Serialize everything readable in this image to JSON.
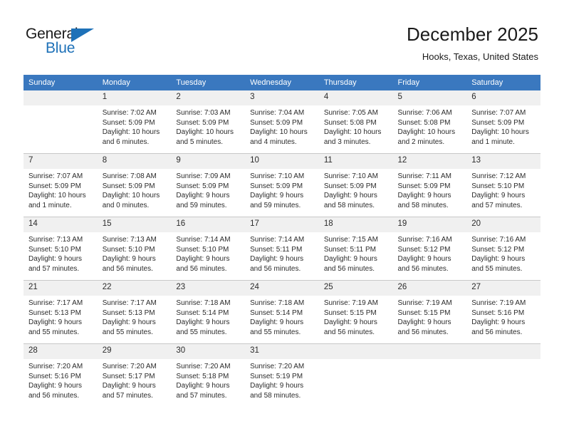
{
  "brand": {
    "name_part1": "General",
    "name_part2": "Blue",
    "triangle_icon": "triangle-icon",
    "color_dark": "#1a1a1a",
    "color_blue": "#1e71b8"
  },
  "header": {
    "title": "December 2025",
    "subtitle": "Hooks, Texas, United States"
  },
  "theme": {
    "header_bg": "#3a78bf",
    "header_text": "#ffffff",
    "daynum_bg": "#f0f0f0",
    "row_divider": "#c8c8c8",
    "body_text": "#2b2b2b"
  },
  "weekdays": [
    "Sunday",
    "Monday",
    "Tuesday",
    "Wednesday",
    "Thursday",
    "Friday",
    "Saturday"
  ],
  "weeks": [
    [
      {
        "day": "",
        "sunrise": "",
        "sunset": "",
        "daylight_line1": "",
        "daylight_line2": ""
      },
      {
        "day": "1",
        "sunrise": "Sunrise: 7:02 AM",
        "sunset": "Sunset: 5:09 PM",
        "daylight_line1": "Daylight: 10 hours",
        "daylight_line2": "and 6 minutes."
      },
      {
        "day": "2",
        "sunrise": "Sunrise: 7:03 AM",
        "sunset": "Sunset: 5:09 PM",
        "daylight_line1": "Daylight: 10 hours",
        "daylight_line2": "and 5 minutes."
      },
      {
        "day": "3",
        "sunrise": "Sunrise: 7:04 AM",
        "sunset": "Sunset: 5:09 PM",
        "daylight_line1": "Daylight: 10 hours",
        "daylight_line2": "and 4 minutes."
      },
      {
        "day": "4",
        "sunrise": "Sunrise: 7:05 AM",
        "sunset": "Sunset: 5:08 PM",
        "daylight_line1": "Daylight: 10 hours",
        "daylight_line2": "and 3 minutes."
      },
      {
        "day": "5",
        "sunrise": "Sunrise: 7:06 AM",
        "sunset": "Sunset: 5:08 PM",
        "daylight_line1": "Daylight: 10 hours",
        "daylight_line2": "and 2 minutes."
      },
      {
        "day": "6",
        "sunrise": "Sunrise: 7:07 AM",
        "sunset": "Sunset: 5:09 PM",
        "daylight_line1": "Daylight: 10 hours",
        "daylight_line2": "and 1 minute."
      }
    ],
    [
      {
        "day": "7",
        "sunrise": "Sunrise: 7:07 AM",
        "sunset": "Sunset: 5:09 PM",
        "daylight_line1": "Daylight: 10 hours",
        "daylight_line2": "and 1 minute."
      },
      {
        "day": "8",
        "sunrise": "Sunrise: 7:08 AM",
        "sunset": "Sunset: 5:09 PM",
        "daylight_line1": "Daylight: 10 hours",
        "daylight_line2": "and 0 minutes."
      },
      {
        "day": "9",
        "sunrise": "Sunrise: 7:09 AM",
        "sunset": "Sunset: 5:09 PM",
        "daylight_line1": "Daylight: 9 hours",
        "daylight_line2": "and 59 minutes."
      },
      {
        "day": "10",
        "sunrise": "Sunrise: 7:10 AM",
        "sunset": "Sunset: 5:09 PM",
        "daylight_line1": "Daylight: 9 hours",
        "daylight_line2": "and 59 minutes."
      },
      {
        "day": "11",
        "sunrise": "Sunrise: 7:10 AM",
        "sunset": "Sunset: 5:09 PM",
        "daylight_line1": "Daylight: 9 hours",
        "daylight_line2": "and 58 minutes."
      },
      {
        "day": "12",
        "sunrise": "Sunrise: 7:11 AM",
        "sunset": "Sunset: 5:09 PM",
        "daylight_line1": "Daylight: 9 hours",
        "daylight_line2": "and 58 minutes."
      },
      {
        "day": "13",
        "sunrise": "Sunrise: 7:12 AM",
        "sunset": "Sunset: 5:10 PM",
        "daylight_line1": "Daylight: 9 hours",
        "daylight_line2": "and 57 minutes."
      }
    ],
    [
      {
        "day": "14",
        "sunrise": "Sunrise: 7:13 AM",
        "sunset": "Sunset: 5:10 PM",
        "daylight_line1": "Daylight: 9 hours",
        "daylight_line2": "and 57 minutes."
      },
      {
        "day": "15",
        "sunrise": "Sunrise: 7:13 AM",
        "sunset": "Sunset: 5:10 PM",
        "daylight_line1": "Daylight: 9 hours",
        "daylight_line2": "and 56 minutes."
      },
      {
        "day": "16",
        "sunrise": "Sunrise: 7:14 AM",
        "sunset": "Sunset: 5:10 PM",
        "daylight_line1": "Daylight: 9 hours",
        "daylight_line2": "and 56 minutes."
      },
      {
        "day": "17",
        "sunrise": "Sunrise: 7:14 AM",
        "sunset": "Sunset: 5:11 PM",
        "daylight_line1": "Daylight: 9 hours",
        "daylight_line2": "and 56 minutes."
      },
      {
        "day": "18",
        "sunrise": "Sunrise: 7:15 AM",
        "sunset": "Sunset: 5:11 PM",
        "daylight_line1": "Daylight: 9 hours",
        "daylight_line2": "and 56 minutes."
      },
      {
        "day": "19",
        "sunrise": "Sunrise: 7:16 AM",
        "sunset": "Sunset: 5:12 PM",
        "daylight_line1": "Daylight: 9 hours",
        "daylight_line2": "and 56 minutes."
      },
      {
        "day": "20",
        "sunrise": "Sunrise: 7:16 AM",
        "sunset": "Sunset: 5:12 PM",
        "daylight_line1": "Daylight: 9 hours",
        "daylight_line2": "and 55 minutes."
      }
    ],
    [
      {
        "day": "21",
        "sunrise": "Sunrise: 7:17 AM",
        "sunset": "Sunset: 5:13 PM",
        "daylight_line1": "Daylight: 9 hours",
        "daylight_line2": "and 55 minutes."
      },
      {
        "day": "22",
        "sunrise": "Sunrise: 7:17 AM",
        "sunset": "Sunset: 5:13 PM",
        "daylight_line1": "Daylight: 9 hours",
        "daylight_line2": "and 55 minutes."
      },
      {
        "day": "23",
        "sunrise": "Sunrise: 7:18 AM",
        "sunset": "Sunset: 5:14 PM",
        "daylight_line1": "Daylight: 9 hours",
        "daylight_line2": "and 55 minutes."
      },
      {
        "day": "24",
        "sunrise": "Sunrise: 7:18 AM",
        "sunset": "Sunset: 5:14 PM",
        "daylight_line1": "Daylight: 9 hours",
        "daylight_line2": "and 55 minutes."
      },
      {
        "day": "25",
        "sunrise": "Sunrise: 7:19 AM",
        "sunset": "Sunset: 5:15 PM",
        "daylight_line1": "Daylight: 9 hours",
        "daylight_line2": "and 56 minutes."
      },
      {
        "day": "26",
        "sunrise": "Sunrise: 7:19 AM",
        "sunset": "Sunset: 5:15 PM",
        "daylight_line1": "Daylight: 9 hours",
        "daylight_line2": "and 56 minutes."
      },
      {
        "day": "27",
        "sunrise": "Sunrise: 7:19 AM",
        "sunset": "Sunset: 5:16 PM",
        "daylight_line1": "Daylight: 9 hours",
        "daylight_line2": "and 56 minutes."
      }
    ],
    [
      {
        "day": "28",
        "sunrise": "Sunrise: 7:20 AM",
        "sunset": "Sunset: 5:16 PM",
        "daylight_line1": "Daylight: 9 hours",
        "daylight_line2": "and 56 minutes."
      },
      {
        "day": "29",
        "sunrise": "Sunrise: 7:20 AM",
        "sunset": "Sunset: 5:17 PM",
        "daylight_line1": "Daylight: 9 hours",
        "daylight_line2": "and 57 minutes."
      },
      {
        "day": "30",
        "sunrise": "Sunrise: 7:20 AM",
        "sunset": "Sunset: 5:18 PM",
        "daylight_line1": "Daylight: 9 hours",
        "daylight_line2": "and 57 minutes."
      },
      {
        "day": "31",
        "sunrise": "Sunrise: 7:20 AM",
        "sunset": "Sunset: 5:19 PM",
        "daylight_line1": "Daylight: 9 hours",
        "daylight_line2": "and 58 minutes."
      },
      {
        "day": "",
        "sunrise": "",
        "sunset": "",
        "daylight_line1": "",
        "daylight_line2": ""
      },
      {
        "day": "",
        "sunrise": "",
        "sunset": "",
        "daylight_line1": "",
        "daylight_line2": ""
      },
      {
        "day": "",
        "sunrise": "",
        "sunset": "",
        "daylight_line1": "",
        "daylight_line2": ""
      }
    ]
  ]
}
